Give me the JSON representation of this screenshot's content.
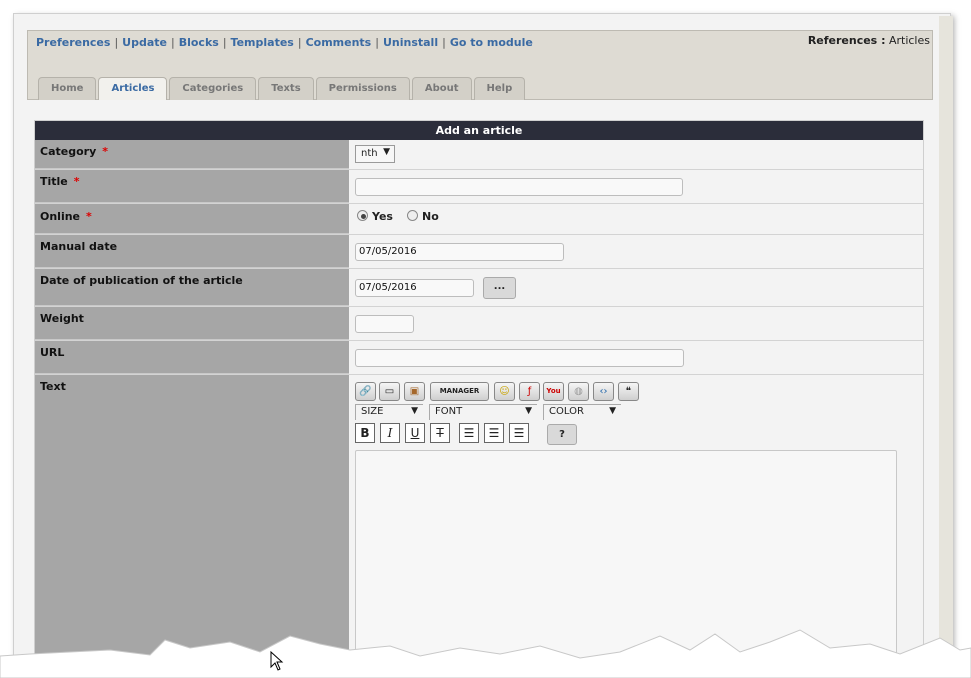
{
  "admin_links": [
    "Preferences",
    "Update",
    "Blocks",
    "Templates",
    "Comments",
    "Uninstall",
    "Go to module"
  ],
  "references": {
    "label": "References :",
    "value": "Articles"
  },
  "tabs": [
    "Home",
    "Articles",
    "Categories",
    "Texts",
    "Permissions",
    "About",
    "Help"
  ],
  "active_tab": "Articles",
  "form": {
    "title": "Add an article",
    "required_mark": "*",
    "fields": {
      "category": {
        "label": "Category",
        "value": "nth"
      },
      "title": {
        "label": "Title",
        "value": ""
      },
      "online": {
        "label": "Online",
        "yes": "Yes",
        "no": "No",
        "selected": "Yes"
      },
      "manual_date": {
        "label": "Manual date",
        "value": "07/05/2016"
      },
      "pub_date": {
        "label": "Date of publication of the article",
        "value": "07/05/2016",
        "button": "..."
      },
      "weight": {
        "label": "Weight",
        "value": ""
      },
      "url": {
        "label": "URL",
        "value": ""
      },
      "text": {
        "label": "Text"
      }
    },
    "editor": {
      "toolbar_icons": [
        "link-icon",
        "image-icon",
        "picture-icon",
        "image-manager-icon",
        "smiley-icon",
        "flash-icon",
        "youtube-icon",
        "wiki-icon",
        "code-icon",
        "quote-icon"
      ],
      "manager_label": "MANAGER",
      "size_label": "SIZE",
      "font_label": "FONT",
      "color_label": "COLOR",
      "bold": "B",
      "italic": "I",
      "underline": "U",
      "strike": "T",
      "help": "?"
    }
  },
  "colors": {
    "header_bg": "#2b2d3a",
    "label_bg": "#a6a6a6",
    "link": "#3a6aa3",
    "required": "#dd0000"
  }
}
